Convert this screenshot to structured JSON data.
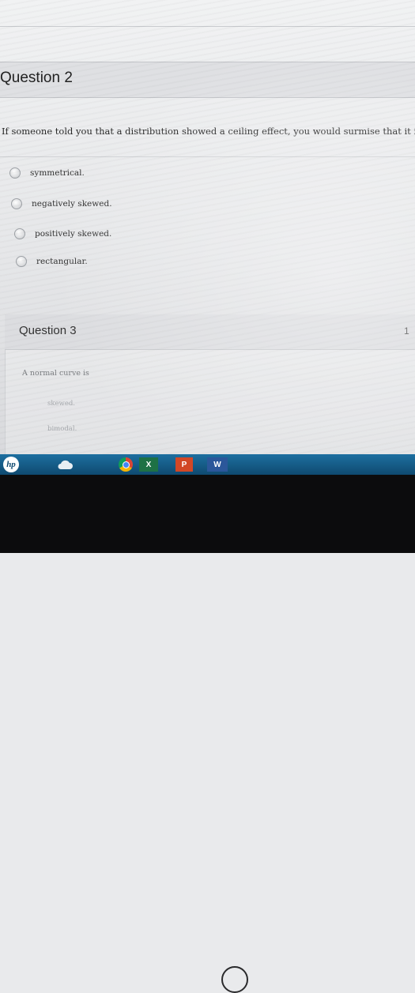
{
  "question2": {
    "title": "Question 2",
    "text": "If someone told you that a distribution showed a ceiling effect, you would surmise that it is",
    "options": [
      {
        "label": "symmetrical."
      },
      {
        "label": "negatively skewed."
      },
      {
        "label": "positively skewed."
      },
      {
        "label": "rectangular."
      }
    ]
  },
  "question3": {
    "title": "Question 3",
    "points": "1",
    "text": "A normal curve is",
    "options": [
      {
        "label": "skewed."
      },
      {
        "label": "bimodal."
      }
    ]
  },
  "taskbar": {
    "icons": [
      "hp-logo",
      "cloud-icon",
      "chrome-icon",
      "excel-icon",
      "powerpoint-icon",
      "word-icon"
    ],
    "hp_text": "hp",
    "excel_text": "X",
    "ppt_text": "P",
    "word_text": "W"
  },
  "colors": {
    "taskbar": "#1d6fa0",
    "bezel": "#0c0c0d",
    "header_band": "#dfe0e3"
  }
}
